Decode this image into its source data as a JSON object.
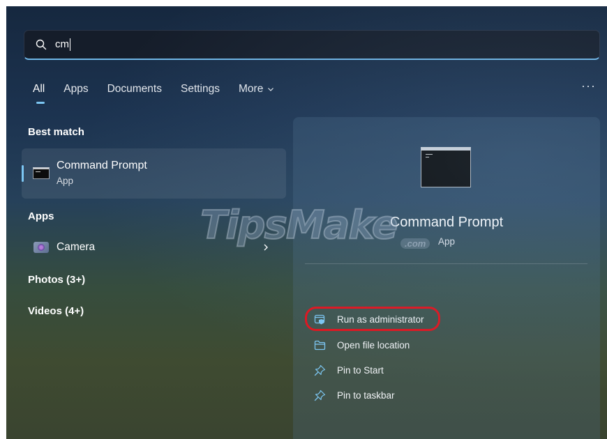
{
  "search": {
    "query": "cm",
    "icon": "search-icon"
  },
  "tabs": [
    {
      "label": "All",
      "active": true
    },
    {
      "label": "Apps"
    },
    {
      "label": "Documents"
    },
    {
      "label": "Settings"
    },
    {
      "label": "More"
    }
  ],
  "overflow_label": "···",
  "results": {
    "best_match_heading": "Best match",
    "best_match": {
      "title": "Command Prompt",
      "subtitle": "App"
    },
    "apps_heading": "Apps",
    "apps": [
      {
        "label": "Camera",
        "icon": "camera-icon"
      }
    ],
    "photos_heading": "Photos (3+)",
    "videos_heading": "Videos (4+)"
  },
  "preview": {
    "title": "Command Prompt",
    "subtitle": "App",
    "actions": [
      {
        "label": "Run as administrator",
        "icon": "shield-admin-icon",
        "highlighted": true
      },
      {
        "label": "Open file location",
        "icon": "folder-icon"
      },
      {
        "label": "Pin to Start",
        "icon": "pin-icon"
      },
      {
        "label": "Pin to taskbar",
        "icon": "pin-icon"
      }
    ]
  },
  "watermark": {
    "text": "TipsMake",
    "suffix": ".com"
  },
  "colors": {
    "accent": "#7cc6f2",
    "highlight_ring": "#e0141e"
  }
}
